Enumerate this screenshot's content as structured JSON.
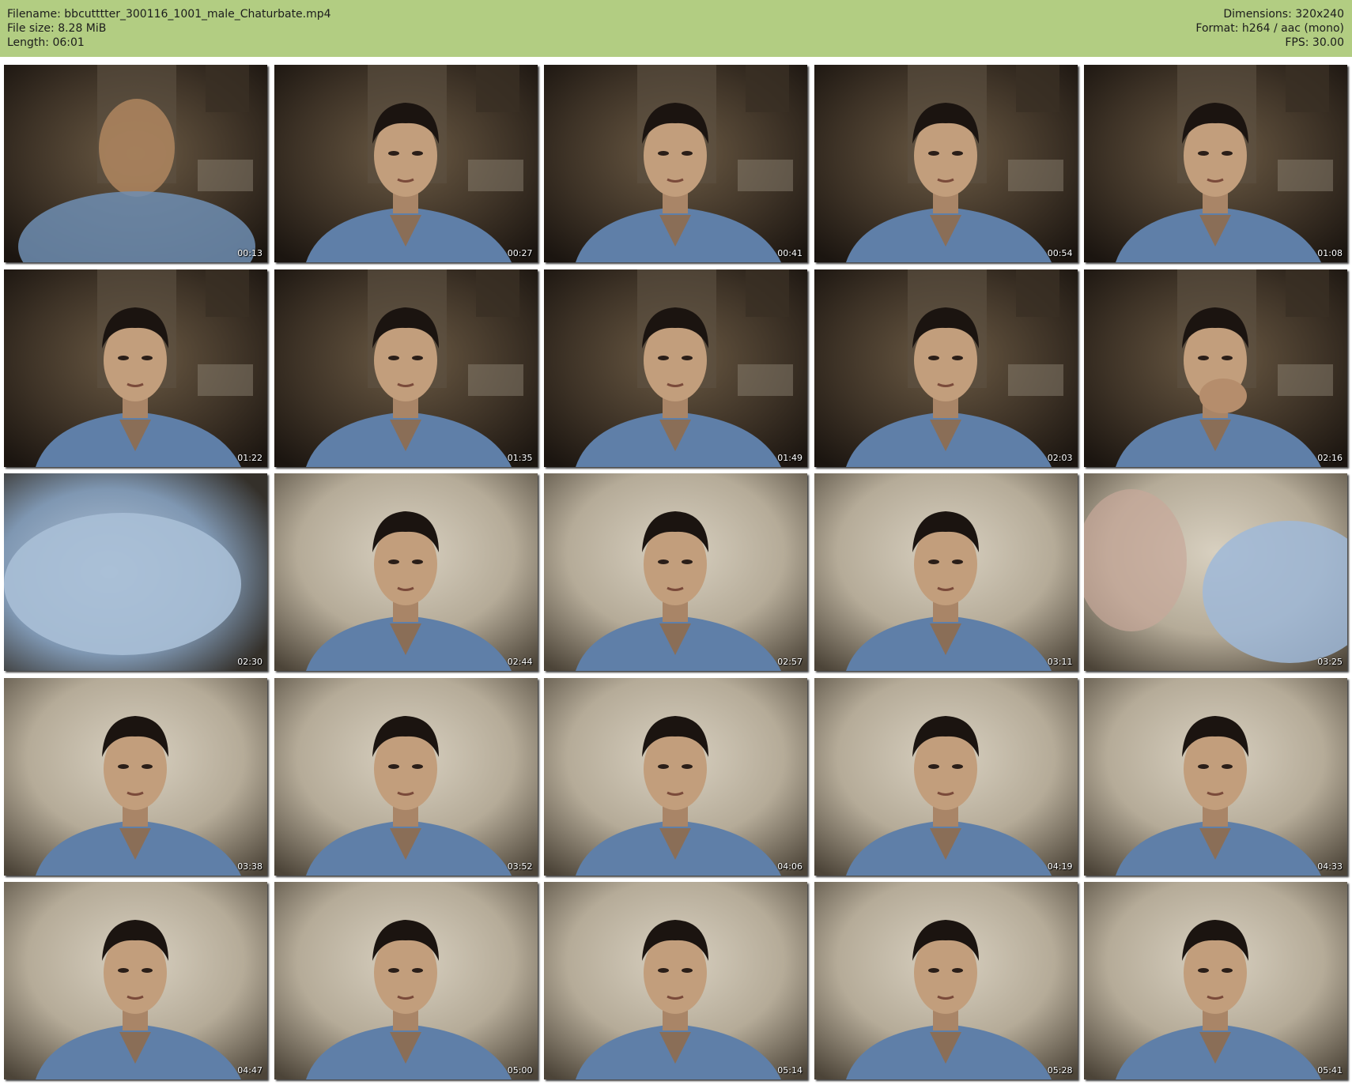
{
  "header": {
    "filename_line": "Filename: bbcutttter_300116_1001_male_Chaturbate.mp4",
    "filesize_line": "File size: 8.28 MiB",
    "length_line": "Length: 06:01",
    "dimensions_line": "Dimensions: 320x240",
    "format_line": "Format: h264 / aac (mono)",
    "fps_line": "FPS: 30.00",
    "background_color": "#b2cd82"
  },
  "thumbnails": [
    {
      "time": "00:13",
      "scene": "dark-blur"
    },
    {
      "time": "00:27",
      "scene": "dark-room"
    },
    {
      "time": "00:41",
      "scene": "dark-room"
    },
    {
      "time": "00:54",
      "scene": "dark-room"
    },
    {
      "time": "01:08",
      "scene": "dark-room"
    },
    {
      "time": "01:22",
      "scene": "dark-room"
    },
    {
      "time": "01:35",
      "scene": "dark-room"
    },
    {
      "time": "01:49",
      "scene": "dark-room"
    },
    {
      "time": "02:03",
      "scene": "dark-room"
    },
    {
      "time": "02:16",
      "scene": "dark-room-hand"
    },
    {
      "time": "02:30",
      "scene": "blue-blur"
    },
    {
      "time": "02:44",
      "scene": "light-wall"
    },
    {
      "time": "02:57",
      "scene": "light-wall"
    },
    {
      "time": "03:11",
      "scene": "light-wall"
    },
    {
      "time": "03:25",
      "scene": "light-blur"
    },
    {
      "time": "03:38",
      "scene": "light-wall"
    },
    {
      "time": "03:52",
      "scene": "light-wall"
    },
    {
      "time": "04:06",
      "scene": "light-wall"
    },
    {
      "time": "04:19",
      "scene": "light-wall"
    },
    {
      "time": "04:33",
      "scene": "light-wall"
    },
    {
      "time": "04:47",
      "scene": "light-wall"
    },
    {
      "time": "05:00",
      "scene": "light-wall"
    },
    {
      "time": "05:14",
      "scene": "light-wall"
    },
    {
      "time": "05:28",
      "scene": "light-wall"
    },
    {
      "time": "05:41",
      "scene": "light-wall"
    }
  ]
}
